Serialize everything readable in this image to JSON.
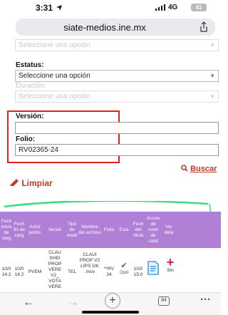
{
  "status": {
    "time": "3:31",
    "network": "4G",
    "battery": "41"
  },
  "browser": {
    "url": "siate-medios.ine.mx"
  },
  "form": {
    "top_select": {
      "placeholder": "Seleccione una opción"
    },
    "estatus": {
      "label": "Estatus:",
      "value": "Seleccione una opción"
    },
    "duracion": {
      "label": "Duración:",
      "value": "Seleccione una opción"
    },
    "version": {
      "label": "Versión:",
      "value": ""
    },
    "folio": {
      "label": "Folio:",
      "value": "RV02365-24"
    },
    "buscar_label": "Buscar",
    "limpiar_label": "Limpiar"
  },
  "table": {
    "headers": [
      "Fech inicio de carg",
      "Fech fin de carg",
      "Actor polític",
      "Versió",
      "Tipo de medi",
      "Nombre del archivo",
      "Folio",
      "Esta",
      "Fech del dictá",
      "Acuse de contr de calid",
      "Ver deta"
    ],
    "row": {
      "fecha_inicio": "10/0 14:2",
      "fecha_fin": "10/0 14:2",
      "actor": "PVEM",
      "version": "CLAU SHEI PROP VERE V2_ VOTA VERE",
      "tipo": "TEL",
      "nombre": "CLAUI PROP V2 LIPS OK .mov",
      "folio": "**RV 24",
      "estado": "Opti",
      "fecha_dictamen": "10/0 15:0",
      "acuse": "Sin"
    }
  },
  "toolbar": {
    "tabs_count": "84"
  },
  "colors": {
    "accent": "#c0392b",
    "table_header": "#b07fd6",
    "highlight": "#e02020"
  }
}
